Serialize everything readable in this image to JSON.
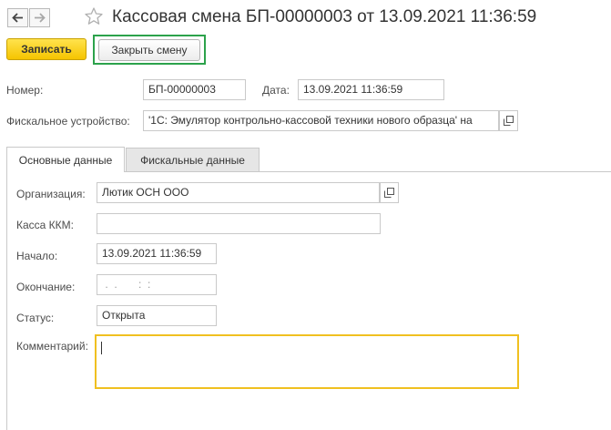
{
  "window": {
    "title": "Кассовая смена БП-00000003 от 13.09.2021 11:36:59"
  },
  "toolbar": {
    "save_label": "Записать",
    "close_shift_label": "Закрыть смену"
  },
  "header": {
    "number_label": "Номер:",
    "number_value": "БП-00000003",
    "date_label": "Дата:",
    "date_value": "13.09.2021 11:36:59",
    "fiscal_device_label": "Фискальное устройство:",
    "fiscal_device_value": "'1С: Эмулятор контрольно-кассовой техники нового образца' на"
  },
  "tabs": [
    {
      "label": "Основные данные",
      "active": true
    },
    {
      "label": "Фискальные данные",
      "active": false
    }
  ],
  "main": {
    "org_label": "Организация:",
    "org_value": "Лютик ОСН ООО",
    "kkm_label": "Касса ККМ:",
    "kkm_value": "",
    "start_label": "Начало:",
    "start_value": "13.09.2021 11:36:59",
    "end_label": "Окончание:",
    "end_value": " .  .       :  :",
    "status_label": "Статус:",
    "status_value": "Открыта",
    "comment_label": "Комментарий:",
    "comment_value": ""
  },
  "colors": {
    "accent": "#f5c400",
    "focus": "#2ca24b",
    "comment_border": "#f0c020"
  },
  "icons": {
    "back": "arrow-left-icon",
    "forward": "arrow-right-icon",
    "favorite": "star-icon",
    "open": "open-icon"
  }
}
